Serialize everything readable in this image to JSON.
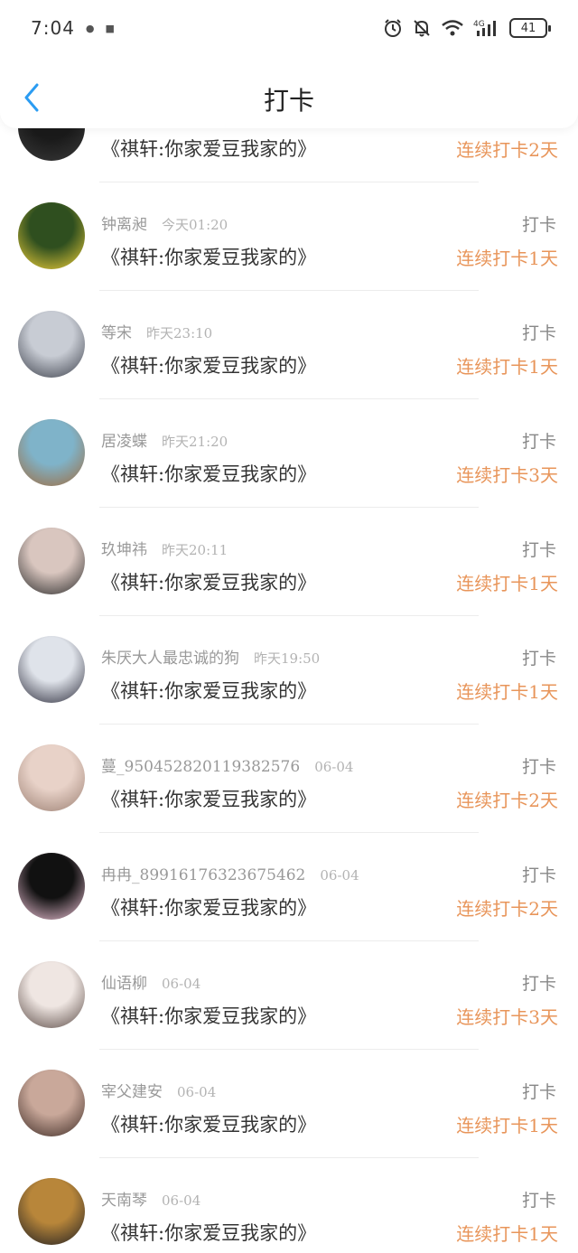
{
  "status_bar": {
    "time": "7:04",
    "battery": "41",
    "icons": [
      "alarm-icon",
      "mute-icon",
      "wifi-icon",
      "4g-signal-icon",
      "battery-icon"
    ]
  },
  "header": {
    "title": "打卡",
    "back_icon": "chevron-left-icon"
  },
  "accent_color": "#e8955a",
  "items": [
    {
      "user": "",
      "time": "",
      "message": "《祺轩:你家爱豆我家的》",
      "action": "",
      "streak": "连续打卡2天",
      "avatar_colors": [
        "#1a1a1a",
        "#3a3a3a"
      ]
    },
    {
      "user": "钟离昶",
      "time": "今天01:20",
      "message": "《祺轩:你家爱豆我家的》",
      "action": "打卡",
      "streak": "连续打卡1天",
      "avatar_colors": [
        "#2f4f1f",
        "#f2d13a"
      ]
    },
    {
      "user": "等宋",
      "time": "昨天23:10",
      "message": "《祺轩:你家爱豆我家的》",
      "action": "打卡",
      "streak": "连续打卡1天",
      "avatar_colors": [
        "#c8ccd4",
        "#3b3f4a"
      ]
    },
    {
      "user": "居凌蝶",
      "time": "昨天21:20",
      "message": "《祺轩:你家爱豆我家的》",
      "action": "打卡",
      "streak": "连续打卡3天",
      "avatar_colors": [
        "#7fb3c9",
        "#a06a3c"
      ]
    },
    {
      "user": "玖坤祎",
      "time": "昨天20:11",
      "message": "《祺轩:你家爱豆我家的》",
      "action": "打卡",
      "streak": "连续打卡1天",
      "avatar_colors": [
        "#d9c6bf",
        "#2a2a2a"
      ]
    },
    {
      "user": "朱厌大人最忠诚的狗",
      "time": "昨天19:50",
      "message": "《祺轩:你家爱豆我家的》",
      "action": "打卡",
      "streak": "连续打卡1天",
      "avatar_colors": [
        "#dfe3ea",
        "#2b2b3a"
      ]
    },
    {
      "user": "蔓_950452820119382576",
      "time": "06-04",
      "message": "《祺轩:你家爱豆我家的》",
      "action": "打卡",
      "streak": "连续打卡2天",
      "avatar_colors": [
        "#e8d2c8",
        "#9b7f72"
      ]
    },
    {
      "user": "冉冉_89916176323675462",
      "time": "06-04",
      "message": "《祺轩:你家爱豆我家的》",
      "action": "打卡",
      "streak": "连续打卡2天",
      "avatar_colors": [
        "#111111",
        "#f0c4d8"
      ]
    },
    {
      "user": "仙语柳",
      "time": "06-04",
      "message": "《祺轩:你家爱豆我家的》",
      "action": "打卡",
      "streak": "连续打卡3天",
      "avatar_colors": [
        "#efe6e2",
        "#5a4a45"
      ]
    },
    {
      "user": "宰父建安",
      "time": "06-04",
      "message": "《祺轩:你家爱豆我家的》",
      "action": "打卡",
      "streak": "连续打卡1天",
      "avatar_colors": [
        "#c9a89a",
        "#3d2a24"
      ]
    },
    {
      "user": "天南琴",
      "time": "06-04",
      "message": "《祺轩:你家爱豆我家的》",
      "action": "打卡",
      "streak": "连续打卡1天",
      "avatar_colors": [
        "#b8863a",
        "#1d1d22"
      ]
    }
  ]
}
